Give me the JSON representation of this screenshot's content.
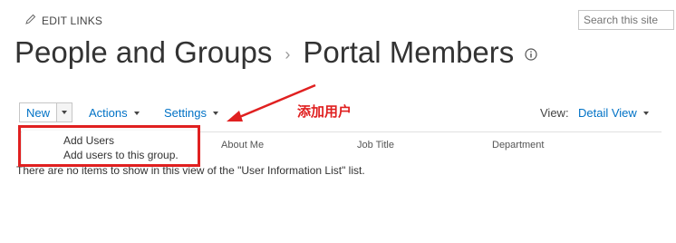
{
  "top_bar": {
    "edit_links_label": "EDIT LINKS",
    "search_placeholder": "Search this site"
  },
  "title": {
    "site": "People and Groups",
    "separator": "›",
    "page": "Portal Members"
  },
  "toolbar": {
    "new_label": "New",
    "actions_label": "Actions",
    "settings_label": "Settings",
    "view_label": "View:",
    "view_value": "Detail View"
  },
  "columns": [
    "About Me",
    "Job Title",
    "Department"
  ],
  "empty_message": "There are no items to show in this view of the \"User Information List\" list.",
  "new_menu": {
    "items": [
      {
        "title": "Add Users",
        "description": "Add users to this group."
      }
    ]
  },
  "annotation": {
    "text": "添加用户",
    "color": "#e02020"
  },
  "colors": {
    "link": "#0072c6",
    "text": "#333333"
  },
  "icons": [
    "pencil-icon",
    "info-icon",
    "chevron-down-icon",
    "arrow-annotation"
  ]
}
